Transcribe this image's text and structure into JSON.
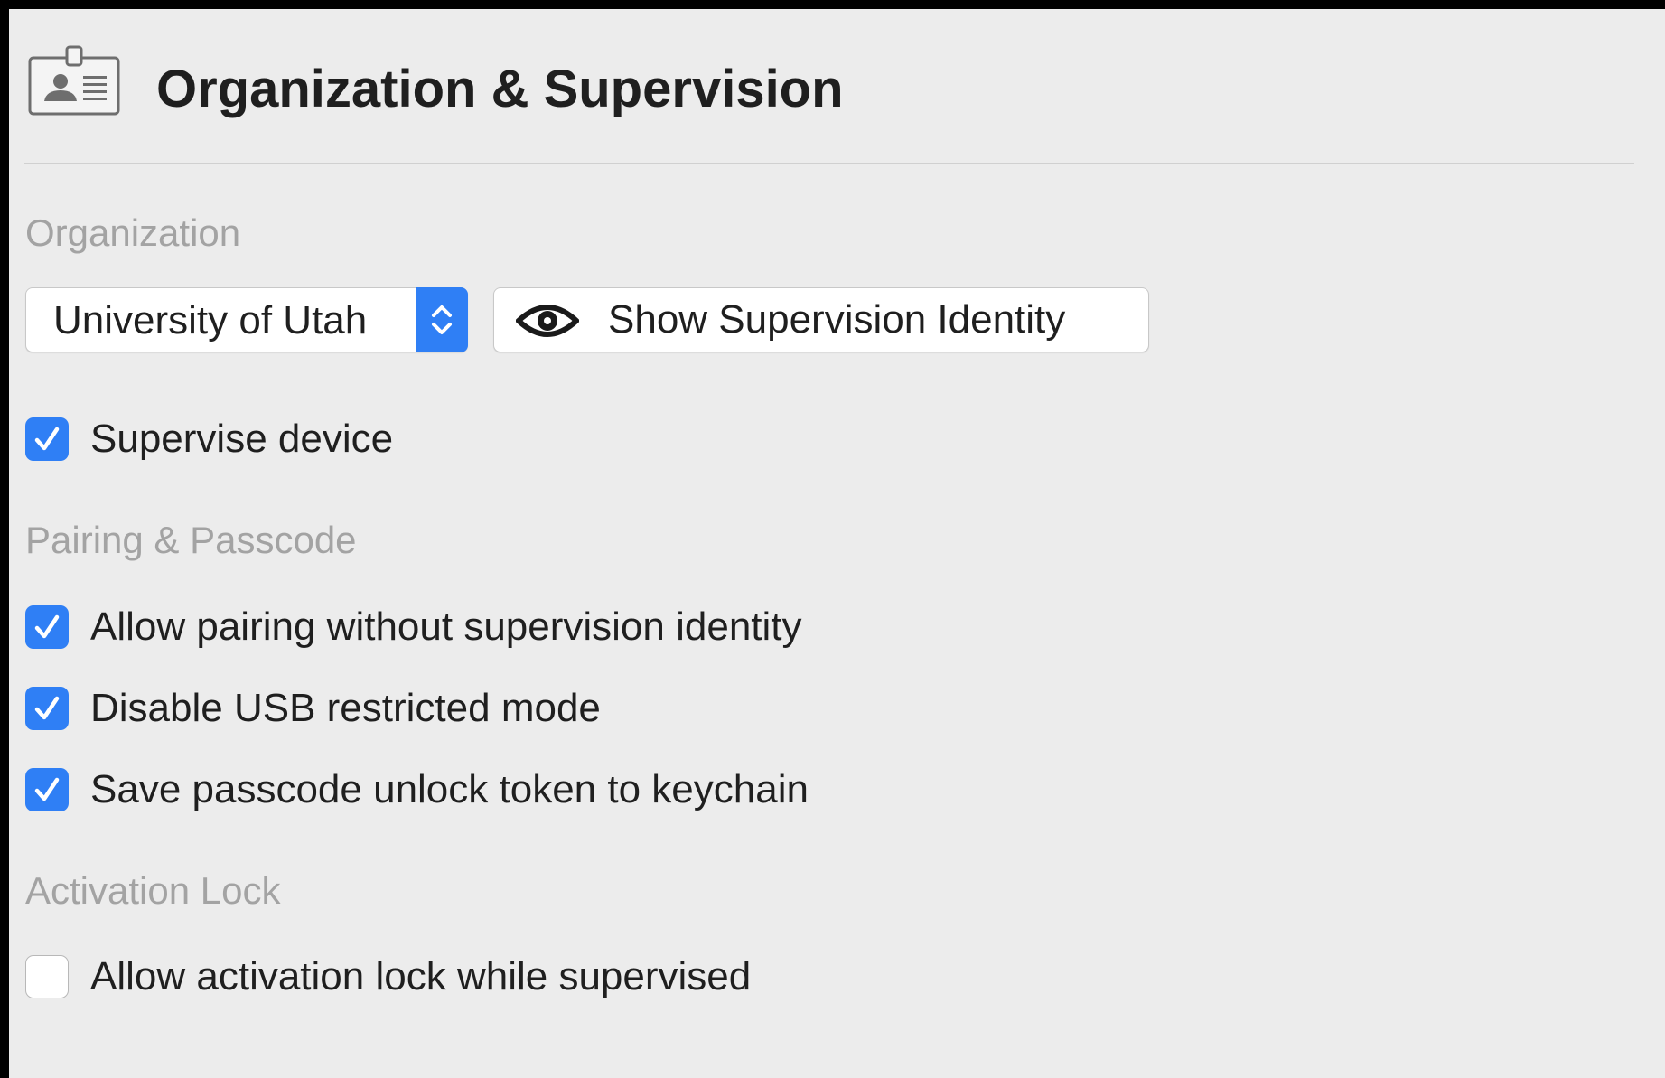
{
  "header": {
    "title": "Organization & Supervision",
    "icon": "id-card-icon"
  },
  "organization": {
    "section_label": "Organization",
    "popup": {
      "selected": "University of Utah"
    },
    "show_identity_button": {
      "label": "Show Supervision Identity",
      "icon": "eye-icon"
    },
    "supervise_device": {
      "label": "Supervise device",
      "checked": true
    }
  },
  "pairing": {
    "section_label": "Pairing & Passcode",
    "items": [
      {
        "label": "Allow pairing without supervision identity",
        "checked": true
      },
      {
        "label": "Disable USB restricted mode",
        "checked": true
      },
      {
        "label": "Save passcode unlock token to keychain",
        "checked": true
      }
    ]
  },
  "activation": {
    "section_label": "Activation Lock",
    "items": [
      {
        "label": "Allow activation lock while supervised",
        "checked": false
      }
    ]
  },
  "colors": {
    "accent": "#2f7ff5",
    "background": "#ececec",
    "section_label": "#a3a3a3",
    "text": "#1f1f1f"
  }
}
